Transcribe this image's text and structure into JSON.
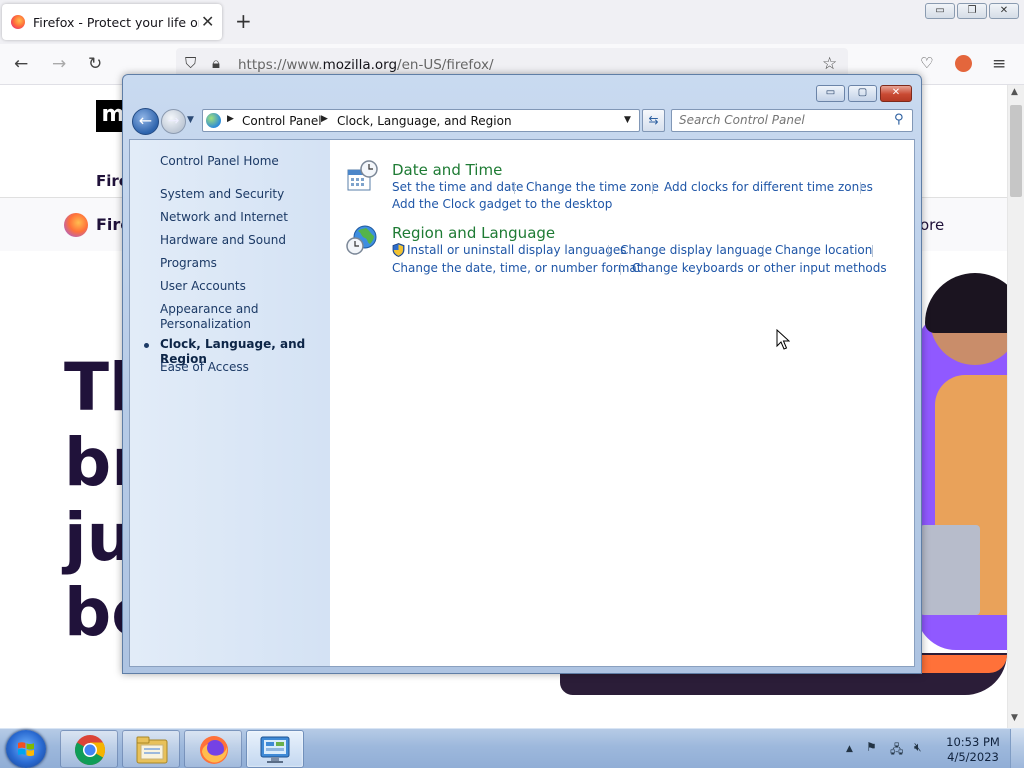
{
  "browser": {
    "tab_title": "Firefox - Protect your life online",
    "tab_close": "✕",
    "new_tab": "+",
    "url_scheme_prefix": "https://www.",
    "url_host": "mozilla.org",
    "url_path": "/en-US/firefox/",
    "window_buttons": {
      "minimize": "▭",
      "restore": "❐",
      "close": "✕"
    }
  },
  "page": {
    "logo_text": "m",
    "nav_text": "Fire",
    "band_brand": "Fire",
    "band_more": "ore",
    "hero_lines": [
      "Th",
      "br",
      "ju",
      "be"
    ]
  },
  "control_panel": {
    "window_buttons": {
      "minimize": "▭",
      "maximize": "▢",
      "close": "✕"
    },
    "breadcrumb": [
      "Control Panel",
      "Clock, Language, and Region"
    ],
    "search_placeholder": "Search Control Panel",
    "sidebar": {
      "home": "Control Panel Home",
      "items": [
        "System and Security",
        "Network and Internet",
        "Hardware and Sound",
        "Programs",
        "User Accounts",
        "Appearance and Personalization",
        "Clock, Language, and Region",
        "Ease of Access"
      ]
    },
    "categories": [
      {
        "title": "Date and Time",
        "icon": "date-time-icon",
        "links": [
          "Set the time and date",
          "Change the time zone",
          "Add clocks for different time zones",
          "Add the Clock gadget to the desktop"
        ]
      },
      {
        "title": "Region and Language",
        "icon": "globe-clock-icon",
        "links": [
          "Install or uninstall display languages",
          "Change display language",
          "Change location",
          "Change the date, time, or number format",
          "Change keyboards or other input methods"
        ]
      }
    ]
  },
  "taskbar": {
    "apps": [
      "chrome-icon",
      "file-explorer-icon",
      "firefox-icon",
      "control-panel-icon"
    ],
    "tray_icons": [
      "show-hidden-icons-arrow",
      "action-center-flag-icon",
      "network-icon",
      "volume-muted-icon"
    ],
    "time": "10:53 PM",
    "date": "4/5/2023"
  }
}
